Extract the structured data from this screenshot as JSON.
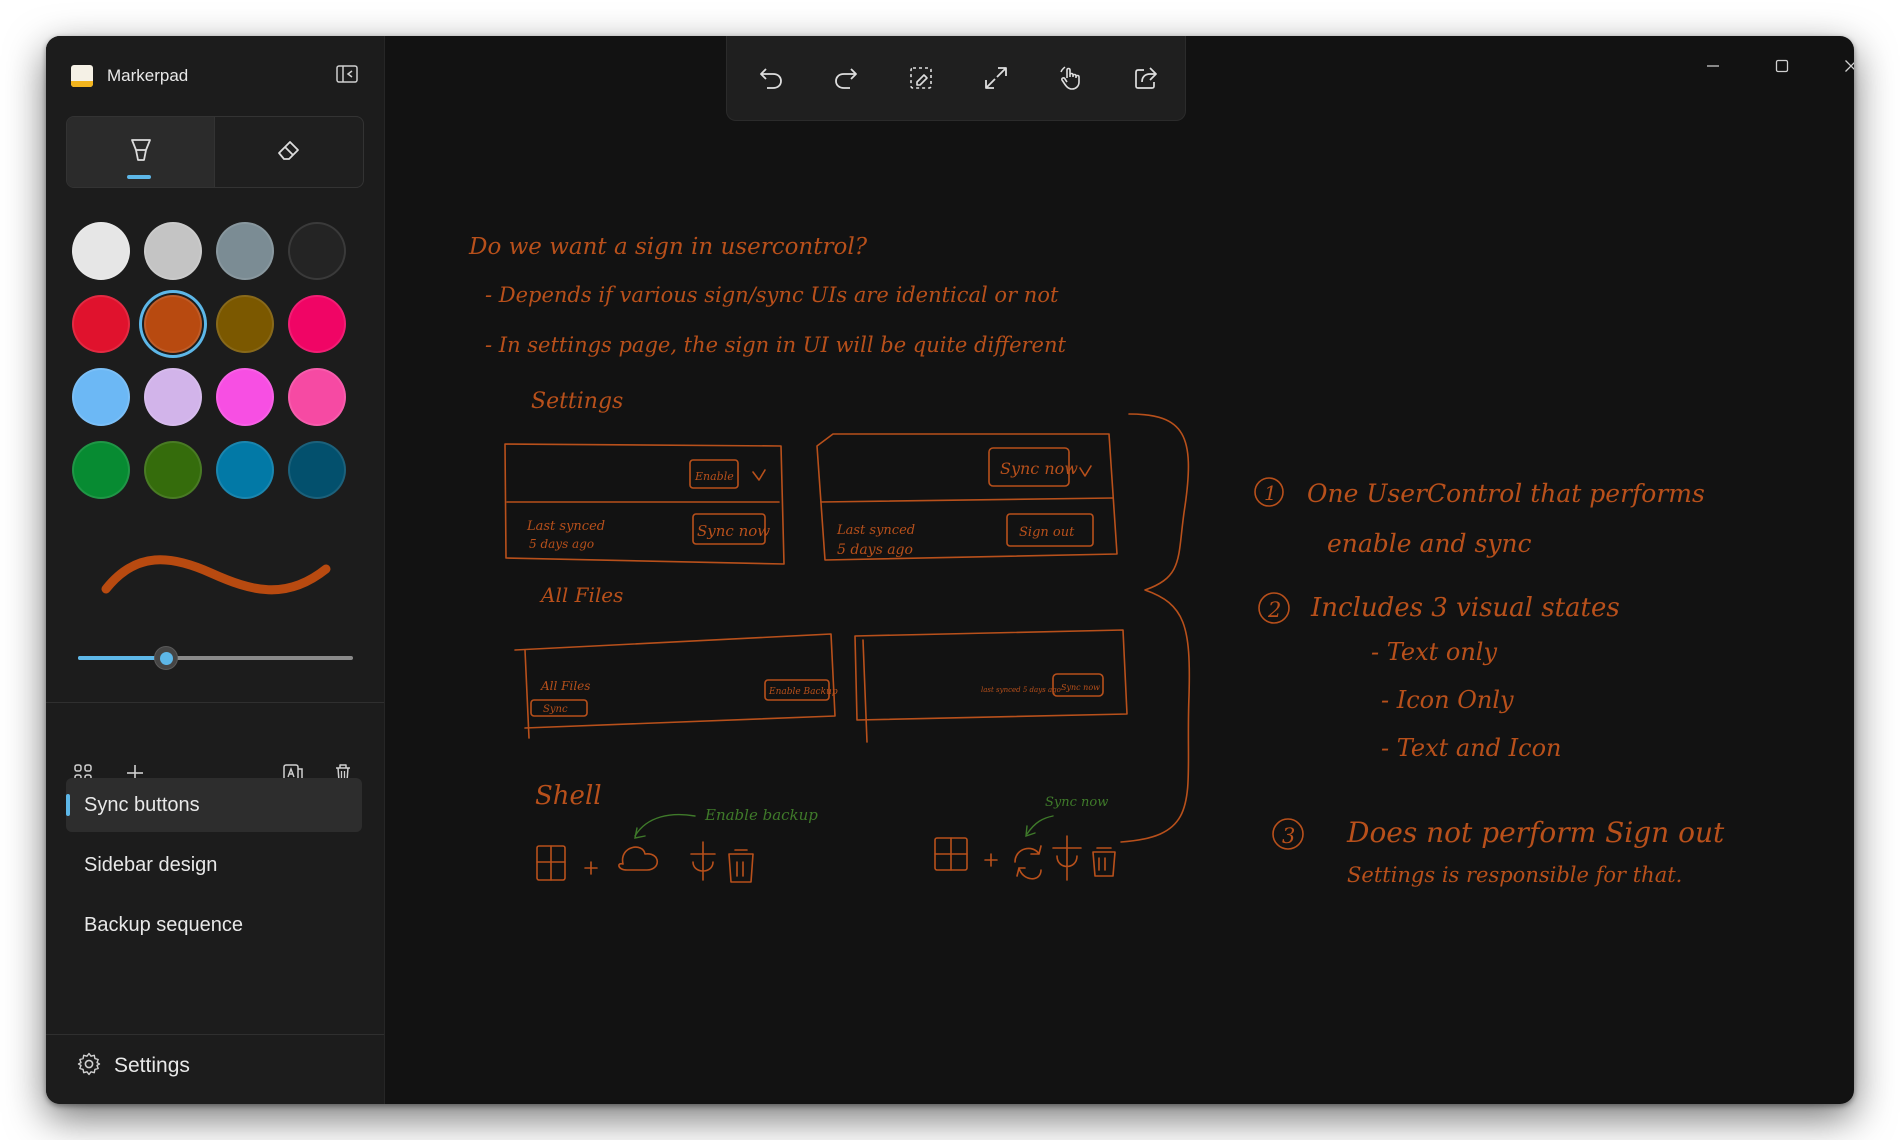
{
  "app": {
    "name": "Markerpad"
  },
  "colors": {
    "accent": "#5db7e8",
    "ink": "#b8501b",
    "green_ink": "#3f7a2a"
  },
  "tool_tabs": [
    {
      "name": "marker",
      "icon": "marker-icon",
      "selected": true
    },
    {
      "name": "eraser",
      "icon": "eraser-icon",
      "selected": false
    }
  ],
  "palette": [
    {
      "color": "#e6e6e6",
      "selected": false
    },
    {
      "color": "#c4c4c4",
      "selected": false
    },
    {
      "color": "#7b8c94",
      "selected": false
    },
    {
      "color": "#242424",
      "selected": false
    },
    {
      "color": "#e0122d",
      "selected": false
    },
    {
      "color": "#b84a10",
      "selected": true
    },
    {
      "color": "#7b5800",
      "selected": false
    },
    {
      "color": "#f00565",
      "selected": false
    },
    {
      "color": "#6cb8f5",
      "selected": false
    },
    {
      "color": "#d2b4ea",
      "selected": false
    },
    {
      "color": "#f74fe3",
      "selected": false
    },
    {
      "color": "#f64aa3",
      "selected": false
    },
    {
      "color": "#078b32",
      "selected": false
    },
    {
      "color": "#356c0c",
      "selected": false
    },
    {
      "color": "#0279a6",
      "selected": false
    },
    {
      "color": "#03506d",
      "selected": false
    }
  ],
  "stroke_size": {
    "value": 0.32
  },
  "page_actions": [
    "grid-icon",
    "add-icon",
    "translate-icon",
    "delete-icon"
  ],
  "pages": [
    {
      "label": "Sync buttons",
      "active": true
    },
    {
      "label": "Sidebar design",
      "active": false
    },
    {
      "label": "Backup sequence",
      "active": false
    }
  ],
  "settings": {
    "label": "Settings"
  },
  "canvas_toolbar": [
    "undo-icon",
    "redo-icon",
    "select-icon",
    "expand-icon",
    "touch-icon",
    "share-icon"
  ],
  "window_controls": [
    "minimize-icon",
    "maximize-icon",
    "close-icon"
  ],
  "notes": {
    "line1": "Do we want a sign in usercontrol?",
    "line2": "- Depends if various sign/sync UIs are identical or not",
    "line3": "- In settings page, the sign in UI will be quite different",
    "settings_label": "Settings",
    "enable": "Enable",
    "last_synced_1": "Last synced",
    "days_ago_1": "5 days ago",
    "sync_now_1": "Sync now",
    "sync_now_2": "Sync now",
    "last_synced_2": "Last synced",
    "days_ago_2": "5 days ago",
    "sign_out": "Sign out",
    "all_files": "All Files",
    "all_files_small": "All Files",
    "sync_small": "Sync",
    "enable_backup_small": "Enable Backup",
    "last_synced_small": "last synced 5 days ago",
    "sync_now_small": "Sync now",
    "shell": "Shell",
    "enable_backup_green": "Enable backup",
    "sync_now_green": "Sync now",
    "r1_num": "1",
    "r1a": "One UserControl that performs",
    "r1b": "enable and sync",
    "r2_num": "2",
    "r2": "Includes 3 visual states",
    "r2a": "- Text only",
    "r2b": "- Icon Only",
    "r2c": "- Text and Icon",
    "r3_num": "3",
    "r3a": "Does not perform Sign out",
    "r3b": "Settings is responsible for that."
  }
}
